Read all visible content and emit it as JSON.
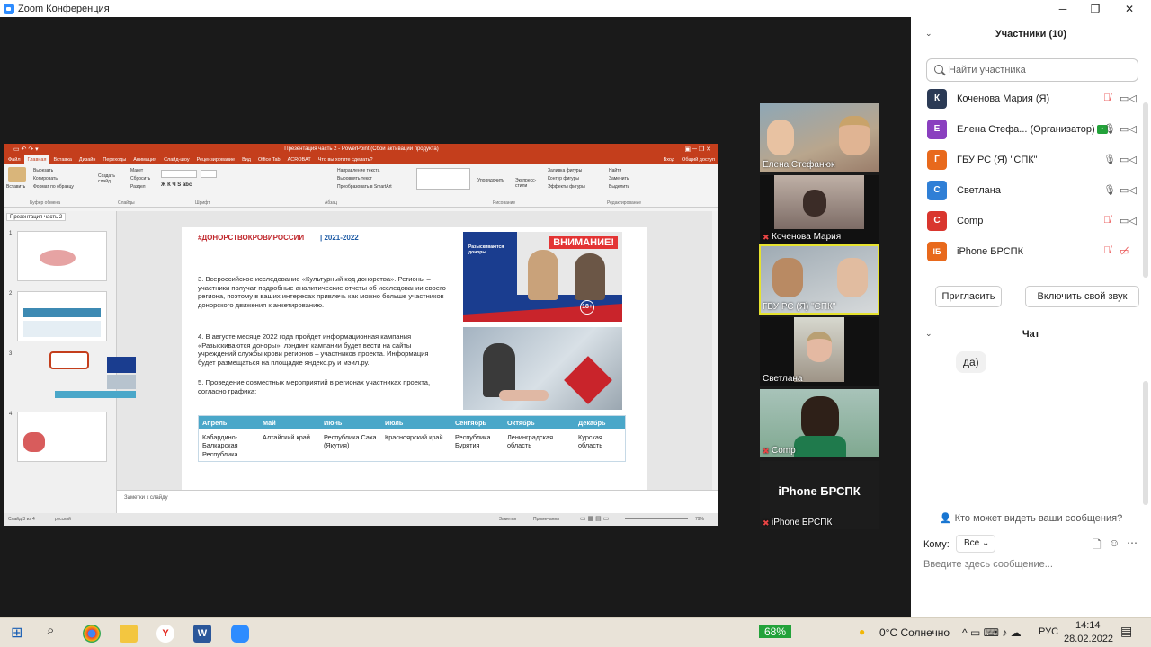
{
  "window": {
    "title": "Zoom Конференция",
    "minimize": "─",
    "restore": "❐",
    "close": "✕"
  },
  "ppt": {
    "title": "Презентация часть 2 - PowerPoint (Сбой активации продукта)",
    "tabs": [
      "Файл",
      "Главная",
      "Вставка",
      "Дизайн",
      "Переходы",
      "Анимация",
      "Слайд-шоу",
      "Рецензирование",
      "Вид",
      "Office Tab",
      "ACROBAT",
      "Что вы хотите сделать?"
    ],
    "active_tab": "Главная",
    "signin": "Вход",
    "share": "Общий доступ",
    "groups": [
      "Буфер обмена",
      "Слайды",
      "Шрифт",
      "Абзац",
      "Рисование",
      "Редактирование"
    ],
    "clipboard": [
      "Вырезать",
      "Копировать",
      "Формат по образцу"
    ],
    "paste": "Вставить",
    "slides_btns": [
      "Макет",
      "Сбросить",
      "Раздел"
    ],
    "new_slide": "Создать слайд",
    "para_btns": [
      "Направление текста",
      "Выровнять текст",
      "Преобразовать в SmartArt"
    ],
    "draw_btns": [
      "Упорядочить",
      "Экспресс-стили"
    ],
    "shape_btns": [
      "Заливка фигуры",
      "Контур фигуры",
      "Эффекты фигуры"
    ],
    "edit_btns": [
      "Найти",
      "Заменить",
      "Выделить"
    ],
    "doc_tab": "Презентация часть 2",
    "slide_numbers": [
      "1",
      "2",
      "3",
      "4"
    ],
    "notes": "Заметки к слайду",
    "status_left": "Слайд 3 из 4",
    "status_lang": "русский",
    "status_notes": "Заметки",
    "status_comments": "Примечания",
    "zoom": "79%"
  },
  "slide": {
    "hashtag": "#ДОНОРСТВОКРОВИРОССИИ",
    "years": "| 2021-2022",
    "para3": "3. Всероссийское исследование «Культурный код донорства». Регионы – участники получат подробные аналитические отчеты об исследовании своего региона, поэтому в ваших интересах привлечь как можно больше участников донорского движения к анкетированию.",
    "para4": "4. В августе месяце 2022 года пройдет информационная кампания «Разыскиваются доноры», лэндинг кампании будет вести на сайты учреждений службы крови регионов – участников проекта. Информация будет размещаться на площадке яндекс.ру и мэил.ру.",
    "para5": "5. Проведение совместных мероприятий в регионах участниках проекта, согласно графика:",
    "promo_title": "ВНИМАНИЕ!",
    "promo_sub": "Разыскиваются доноры",
    "promo_age": "18+",
    "table": {
      "headers": [
        "Апрель",
        "Май",
        "Июнь",
        "Июль",
        "Сентябрь",
        "Октябрь",
        "Декабрь"
      ],
      "cells": [
        "Кабардино-Балкарская Республика",
        "Алтайский край",
        "Республика Саха (Якутия)",
        "Красноярский край",
        "Республика Бурятия",
        "Ленинградская область",
        "Курская область"
      ]
    }
  },
  "tiles": [
    {
      "name": "Елена Стефанюк",
      "muted": false
    },
    {
      "name": "Коченова Мария",
      "muted": true
    },
    {
      "name": "ГБУ РС (Я) \"СПК\"",
      "muted": false
    },
    {
      "name": "Светлана",
      "muted": false
    },
    {
      "name": "Comp",
      "muted": true
    },
    {
      "name": "iPhone БРСПК",
      "muted": true,
      "big": "iPhone БРСПК"
    }
  ],
  "participants": {
    "header": "Участники (10)",
    "search_placeholder": "Найти участника",
    "list": [
      {
        "initial": "К",
        "name": "Коченова Мария (Я)",
        "color": "#2b3a55"
      },
      {
        "initial": "Е",
        "name": "Елена Стефа... (Организатор)",
        "color": "#8a3fbf"
      },
      {
        "initial": "Г",
        "name": "ГБУ РС (Я) \"СПК\"",
        "color": "#e8691c"
      },
      {
        "initial": "С",
        "name": "Светлана",
        "color": "#2f7fd6"
      },
      {
        "initial": "С",
        "name": "Comp",
        "color": "#d9362e"
      },
      {
        "initial": "IБ",
        "name": "iPhone БРСПК",
        "color": "#e8691c"
      }
    ],
    "invite": "Пригласить",
    "unmute": "Включить свой звук"
  },
  "chat": {
    "header": "Чат",
    "message": "да)",
    "who_can_see": "Кто может видеть ваши сообщения?",
    "to_label": "Кому:",
    "to_value": "Все",
    "placeholder": "Введите здесь сообщение..."
  },
  "taskbar": {
    "battery": "68%",
    "weather": "0°C  Солнечно",
    "lang": "РУС",
    "time": "14:14",
    "date": "28.02.2022"
  }
}
